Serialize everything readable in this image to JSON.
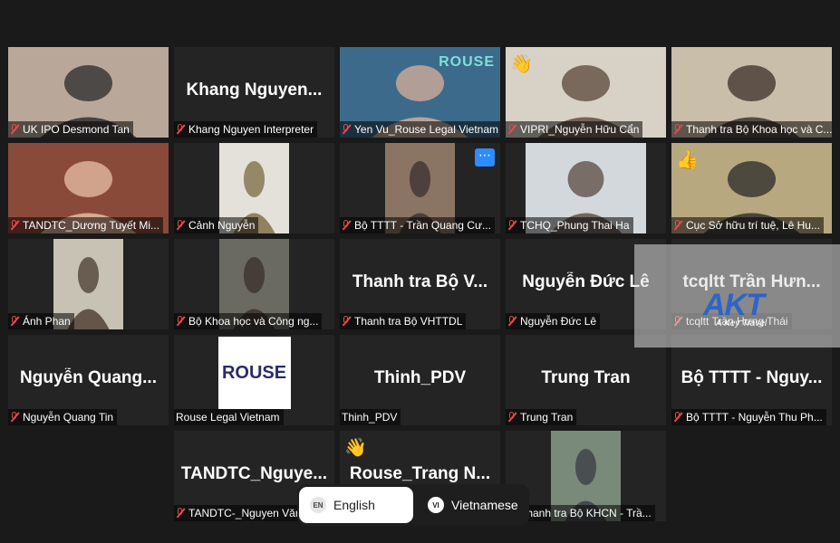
{
  "tiles": [
    {
      "name": "UK IPO Desmond Tan",
      "video": true,
      "bg": "#b9a89a",
      "fg": "#2a2a2a"
    },
    {
      "name": "Khang Nguyen Interpreter",
      "big": "Khang  Nguyen..."
    },
    {
      "name": "Yen Vu_Rouse Legal Vietnam",
      "video": true,
      "bg": "#3c6a8a",
      "fg": "#d8b09a",
      "active": true,
      "overlay": "ROUSE"
    },
    {
      "name": "VIPRI_Nguyễn Hữu Cẩn",
      "video": true,
      "bg": "#d8d2c6",
      "fg": "#5a4638",
      "emoji": "👋"
    },
    {
      "name": "Thanh tra Bộ Khoa học và C...",
      "video": true,
      "bg": "#c9bea9",
      "fg": "#3a2e2a"
    },
    {
      "name": "TANDTC_Dương Tuyết Mi...",
      "video": true,
      "bg": "#8a4a3a",
      "fg": "#e8c0a8"
    },
    {
      "name": "Cảnh Nguyễn",
      "video": true,
      "bg": "#e3e1da",
      "fg": "#7a6a40"
    },
    {
      "name": "Bộ TTTT - Trần Quang Cư...",
      "video": true,
      "bg": "#8a7464",
      "fg": "#3a3030",
      "dots": "⋯"
    },
    {
      "name": "TCHQ_Phung Thai Ha",
      "video": true,
      "bg": "#d3d8dc",
      "fg": "#5a4a40"
    },
    {
      "name": "Cục Sở hữu trí tuệ, Lê Hu...",
      "video": true,
      "bg": "#b8a880",
      "fg": "#2a2a2a",
      "emoji": "👍"
    },
    {
      "name": "Ánh Phan",
      "video": true,
      "bg": "#c8c2b4",
      "fg": "#4a3a30"
    },
    {
      "name": "Bộ Khoa học và Công ng...",
      "video": true,
      "bg": "#6a6a62",
      "fg": "#3a3028"
    },
    {
      "name": "Thanh tra Bộ VHTTDL",
      "big": "Thanh  tra  Bộ  V..."
    },
    {
      "name": "Nguyễn Đức Lê",
      "big": "Nguyễn  Đức  Lê"
    },
    {
      "name": "tcqltt Trần Hưng Thái",
      "big": "tcqltt  Trần  Hưn..."
    },
    {
      "name": "Nguyễn Quang Tin",
      "big": "Nguyễn  Quang..."
    },
    {
      "name": "Rouse Legal Vietnam",
      "logo": "ROUSE",
      "nomic": true
    },
    {
      "name": "Thinh_PDV",
      "big": "Thinh_PDV",
      "nomic": true
    },
    {
      "name": "Trung Tran",
      "big": "Trung  Tran"
    },
    {
      "name": "Bộ TTTT - Nguyễn Thu Ph...",
      "big": "Bộ  TTTT  -  Nguy..."
    },
    {
      "name": "TANDTC-_Nguyen Văn",
      "big": "TANDTC_Nguye..."
    },
    {
      "name": "Rouse_Trang Nguyen",
      "big": "Rouse_Trang  N...",
      "emoji": "👋"
    },
    {
      "name": "Thanh tra Bộ KHCN - Trầ...",
      "video": true,
      "bg": "#7a8a7a",
      "fg": "#3a3a44"
    }
  ],
  "language_bar": {
    "english": {
      "code": "EN",
      "label": "English"
    },
    "vietnamese": {
      "code": "VI",
      "label": "Vietnamese"
    }
  },
  "watermark": {
    "logo": "AKT",
    "tagline": "A Key Travel"
  }
}
